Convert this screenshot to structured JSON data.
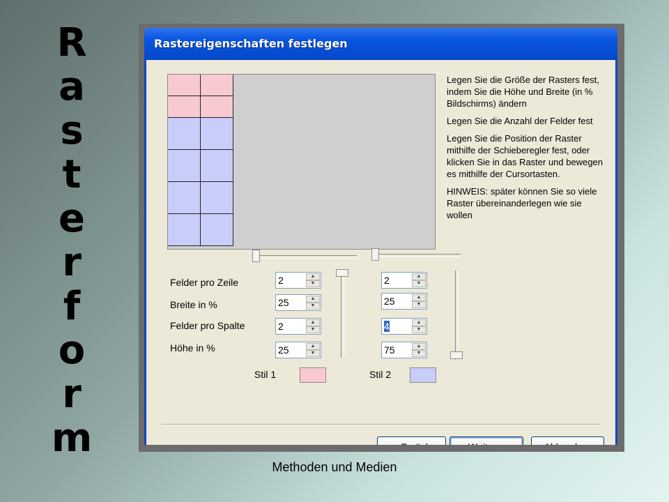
{
  "slide": {
    "vertical_title_letters": [
      "R",
      "a",
      "s",
      "t",
      "e",
      "r",
      "f",
      "o",
      "r",
      "m"
    ],
    "footer": "Methoden und Medien"
  },
  "dialog": {
    "title": "Rastereigenschaften festlegen",
    "info": [
      "Legen Sie die Größe der Rasters fest, indem Sie die Höhe und Breite (in % Bildschirms) ändern",
      "Legen Sie die Anzahl der Felder fest",
      "Legen Sie die Position der Raster mithilfe der Schieberegler fest, oder klicken Sie in das Raster und bewegen es mithilfe der Cursortasten.",
      "HINWEIS: später können Sie so viele Raster übereinanderlegen wie sie wollen"
    ],
    "labels": {
      "felder_pro_zeile": "Felder pro Zeile",
      "breite": "Breite in %",
      "felder_pro_spalte": "Felder pro Spalte",
      "hoehe": "Höhe in %"
    },
    "style1": {
      "label": "Stil 1",
      "color": "#f8c9d0",
      "felder_pro_zeile": "2",
      "breite": "25",
      "felder_pro_spalte": "2",
      "hoehe": "25"
    },
    "style2": {
      "label": "Stil 2",
      "color": "#c8cdfa",
      "felder_pro_zeile": "2",
      "breite": "25",
      "felder_pro_spalte": "4",
      "hoehe": "75"
    },
    "buttons": {
      "back": "< Zurück",
      "next": "Weiter >",
      "cancel": "Abbrechen"
    },
    "preview": {
      "pink_rows": 2,
      "blue_rows": 4,
      "columns": 2
    }
  }
}
